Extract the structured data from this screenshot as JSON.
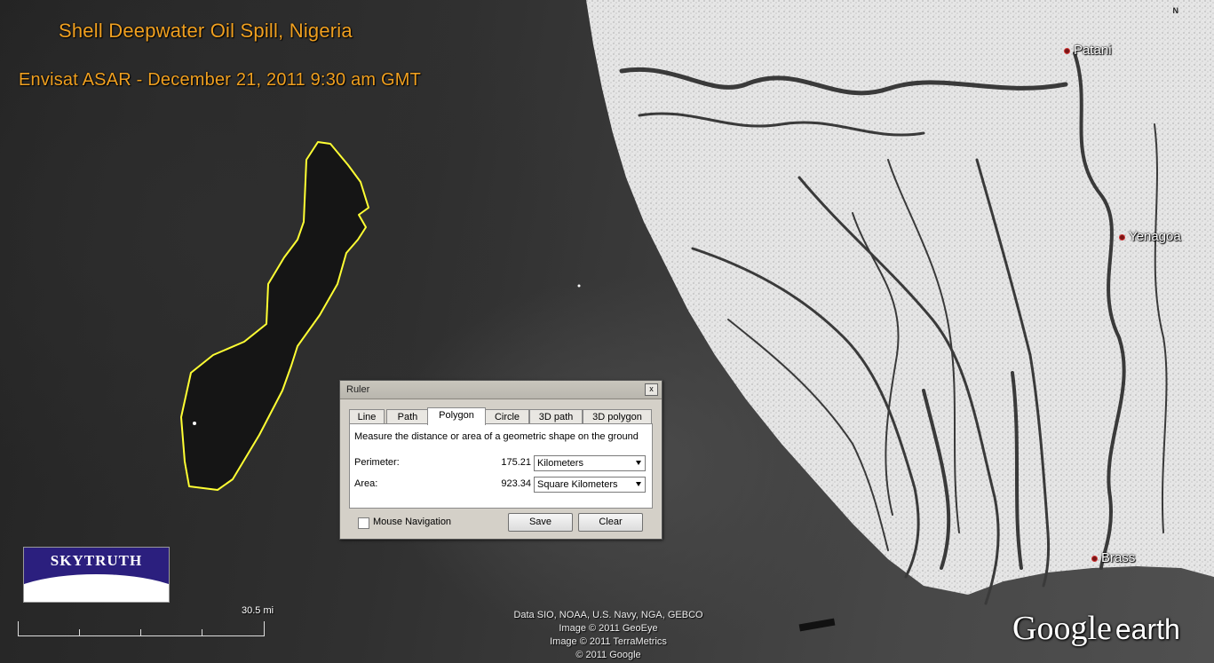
{
  "overlay": {
    "title": "Shell Deepwater Oil Spill, Nigeria",
    "subtitle": "Envisat ASAR - December 21, 2011 9:30 am GMT"
  },
  "places": [
    {
      "name": "Patani"
    },
    {
      "name": "Yenagoa"
    },
    {
      "name": "Brass"
    }
  ],
  "compass": "N",
  "logo": {
    "text": "SKYTRUTH"
  },
  "scale": {
    "label": "30.5 mi"
  },
  "attribution": [
    "Data SIO, NOAA, U.S. Navy, NGA, GEBCO",
    "Image © 2011 GeoEye",
    "Image © 2011 TerraMetrics",
    "© 2011 Google"
  ],
  "brand": {
    "google": "Google",
    "earth": "earth"
  },
  "ruler": {
    "title": "Ruler",
    "close": "x",
    "tabs": [
      "Line",
      "Path",
      "Polygon",
      "Circle",
      "3D path",
      "3D polygon"
    ],
    "active_tab": "Polygon",
    "description": "Measure the distance or area of a geometric shape on the ground",
    "perimeter": {
      "label": "Perimeter:",
      "value": "175.21",
      "unit": "Kilometers"
    },
    "area": {
      "label": "Area:",
      "value": "923.34",
      "unit": "Square Kilometers"
    },
    "mouse_nav_label": "Mouse Navigation",
    "mouse_nav_checked": false,
    "save_label": "Save",
    "clear_label": "Clear"
  },
  "colors": {
    "title": "#f0a020",
    "polygon_outline": "#ffff33",
    "logo_navy": "#2b1f7e",
    "place_dot": "#7a1515"
  }
}
